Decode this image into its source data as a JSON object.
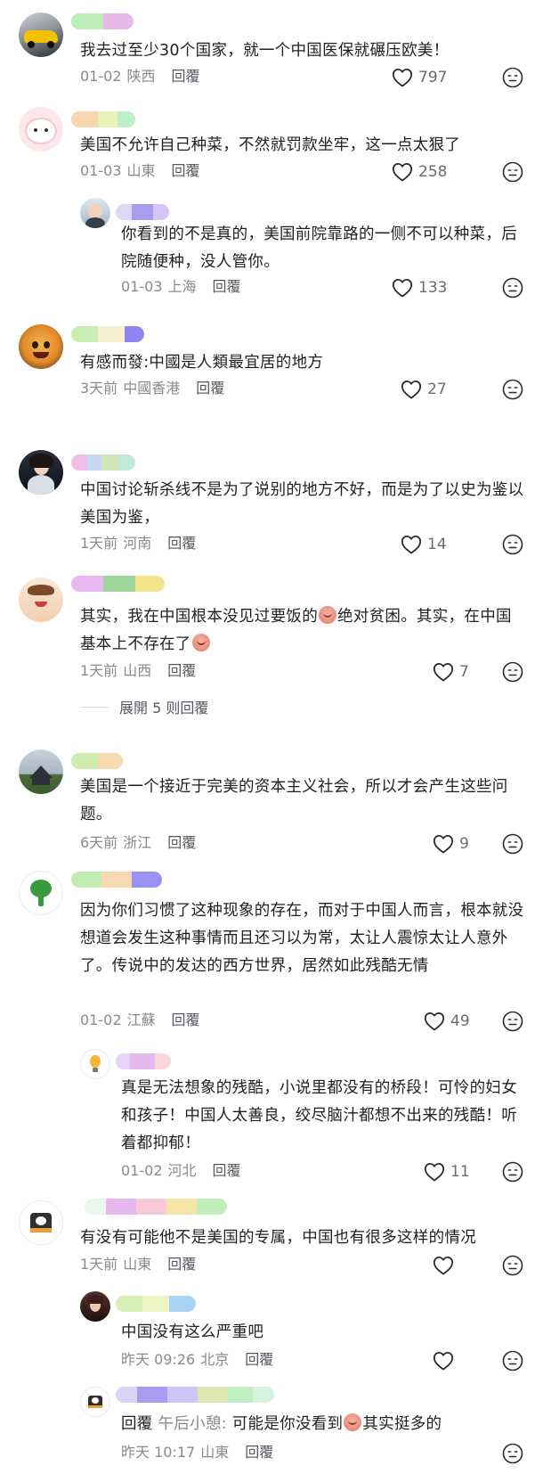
{
  "comments": [
    {
      "text": "我去过至少30个国家，就一个中国医保就碾压欧美！",
      "date": "01-02",
      "loc": "陕西",
      "reply": "回覆",
      "likes": "797"
    },
    {
      "text": "美国不允许自己种菜，不然就罚款坐牢，这一点太狠了",
      "date": "01-03",
      "loc": "山東",
      "reply": "回覆",
      "likes": "258"
    },
    {
      "text": "你看到的不是真的，美国前院靠路的一侧不可以种菜，后院随便种，没人管你。",
      "date": "01-03",
      "loc": "上海",
      "reply": "回覆",
      "likes": "133"
    },
    {
      "text": "有感而發:中國是人類最宜居的地方",
      "date": "3天前",
      "loc": "中國香港",
      "reply": "回覆",
      "likes": "27"
    },
    {
      "text": "中国讨论斩杀线不是为了说别的地方不好，而是为了以史为鉴以美国为鉴，",
      "date": "1天前",
      "loc": "河南",
      "reply": "回覆",
      "likes": "14"
    },
    {
      "text_a": "其实，我在中国根本没见过要饭的",
      "text_b": "绝对贫困。其实，在中国基本上不存在了",
      "date": "1天前",
      "loc": "山西",
      "reply": "回覆",
      "likes": "7"
    },
    {
      "text": "美国是一个接近于完美的资本主义社会，所以才会产生这些问题。",
      "date": "6天前",
      "loc": "浙江",
      "reply": "回覆",
      "likes": "9"
    },
    {
      "text": "因为你们习惯了这种现象的存在，而对于中国人而言，根本就没想道会发生这种事情而且还习以为常，太让人震惊太让人意外了。传说中的发达的西方世界，居然如此残酷无情",
      "date": "01-02",
      "loc": "江蘇",
      "reply": "回覆",
      "likes": "49"
    },
    {
      "text": "真是无法想象的残酷，小说里都没有的桥段！可怜的妇女和孩子！中国人太善良，绞尽脑汁都想不出来的残酷！听着都抑郁！",
      "date": "01-02",
      "loc": "河北",
      "reply": "回覆",
      "likes": "11"
    },
    {
      "text": "有没有可能他不是美国的专属，中国也有很多这样的情况",
      "date": "1天前",
      "loc": "山東",
      "reply": "回覆",
      "likes": ""
    },
    {
      "text": "中国没有这么严重吧",
      "date": "昨天 09:26",
      "loc": "北京",
      "reply": "回覆",
      "likes": ""
    },
    {
      "prefix": "回覆",
      "mention": "午后小憩:",
      "text_a": " 可能是你没看到",
      "text_b": "其实挺多的",
      "date": "昨天 10:17",
      "loc": "山東",
      "reply": "回覆",
      "likes": ""
    }
  ],
  "expand_label": "展開 5 则回覆",
  "colors": {
    "text": "#1f1f1f",
    "meta": "#8a8a8e",
    "icon": "#2b2b2b"
  }
}
